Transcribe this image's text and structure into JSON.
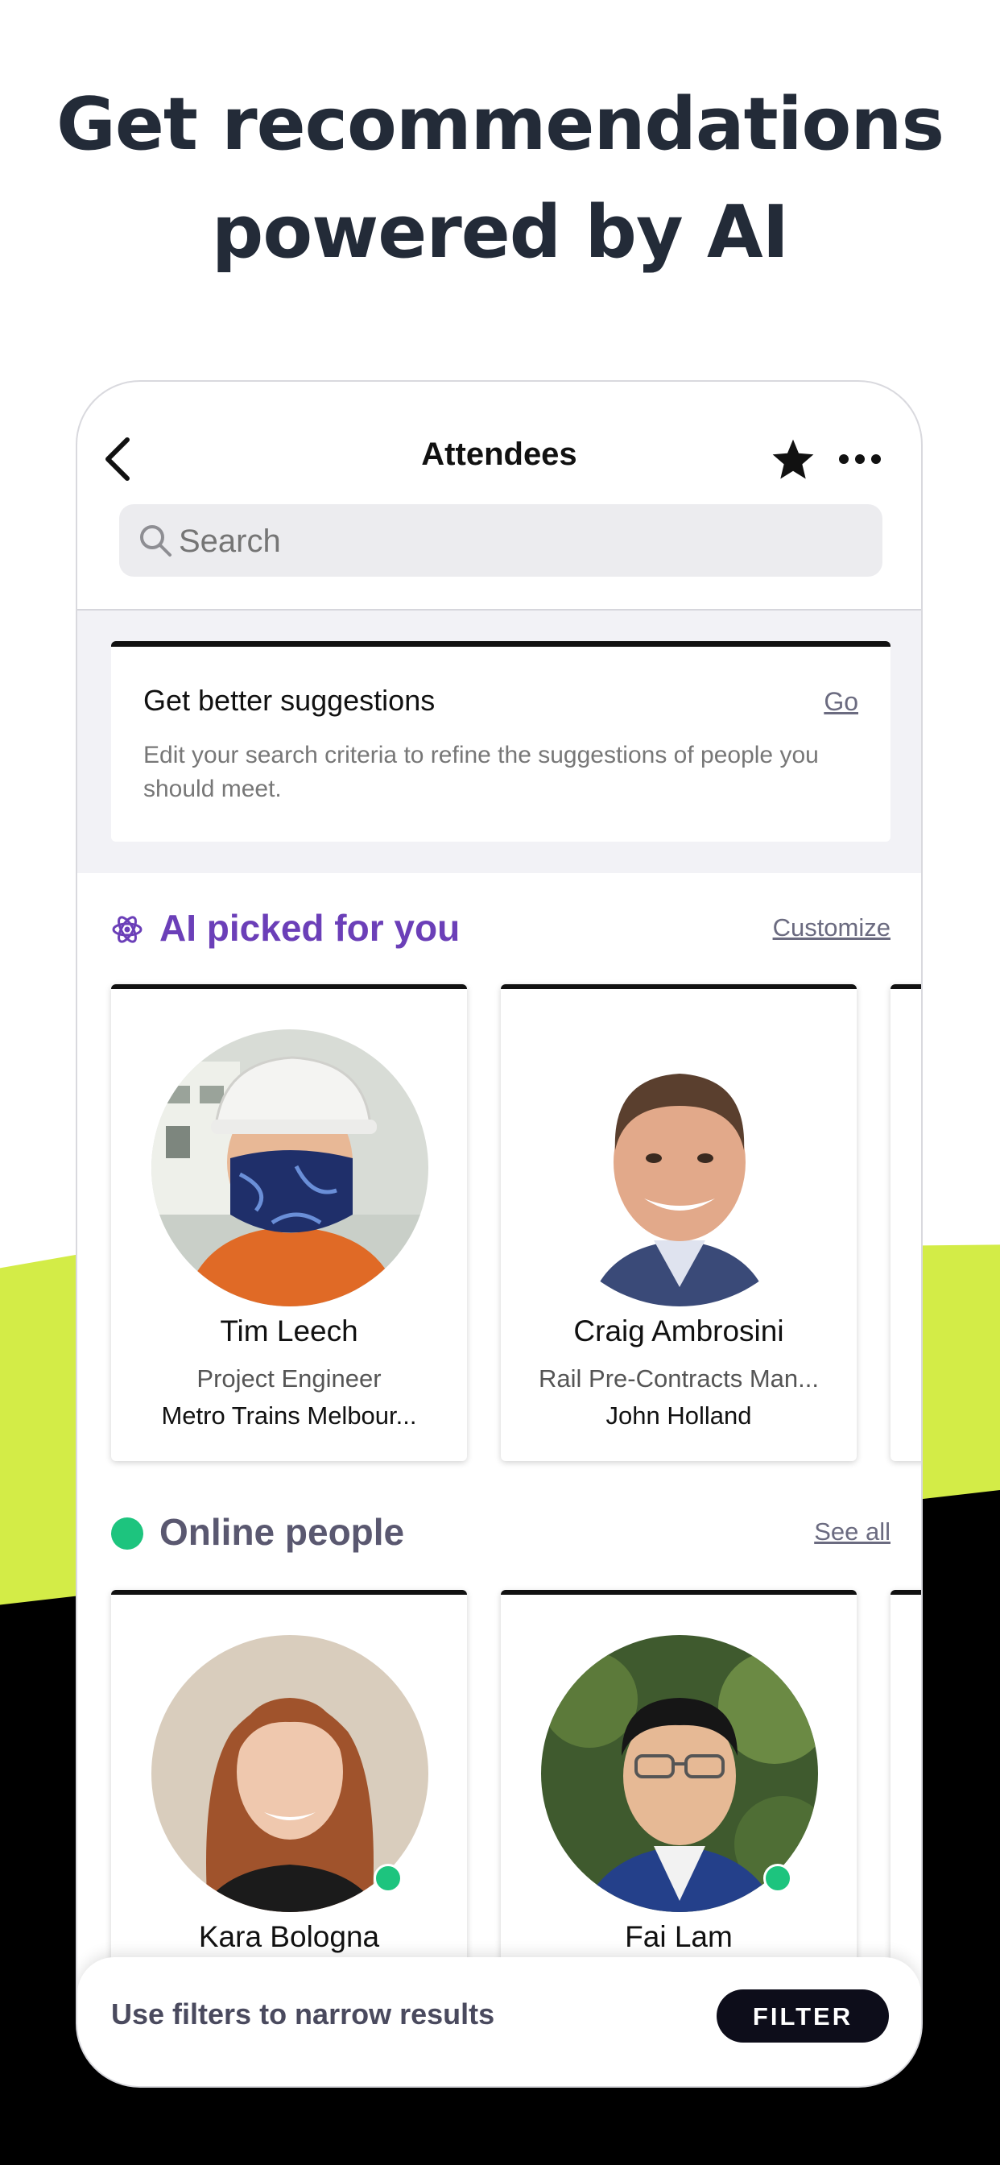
{
  "headline": {
    "line1": "Get recommendations",
    "line2": "powered by AI"
  },
  "colors": {
    "lime": "#d3ec47",
    "ai_purple": "#6b3fb8",
    "online_green": "#1dc47e",
    "section_gray": "#5a5870"
  },
  "header": {
    "title": "Attendees",
    "back_icon": "chevron-left-icon",
    "favorite_icon": "star-icon",
    "more_icon": "ellipsis-icon"
  },
  "search": {
    "placeholder": "Search"
  },
  "suggestions": {
    "title": "Get better suggestions",
    "action": "Go",
    "description": "Edit your search criteria to refine the suggestions of people you should meet."
  },
  "ai_section": {
    "title": "AI picked for you",
    "link": "Customize",
    "icon": "atom-icon"
  },
  "ai_people": [
    {
      "name": "Tim Leech",
      "role": "Project Engineer",
      "org": "Metro Trains Melbour..."
    },
    {
      "name": "Craig Ambrosini",
      "role": "Rail Pre-Contracts Man...",
      "org": "John Holland"
    }
  ],
  "online_section": {
    "title": "Online people",
    "link": "See all"
  },
  "online_people": [
    {
      "name": "Kara Bologna"
    },
    {
      "name": "Fai Lam"
    }
  ],
  "bottom": {
    "text": "Use filters to narrow results",
    "button": "FILTER"
  }
}
